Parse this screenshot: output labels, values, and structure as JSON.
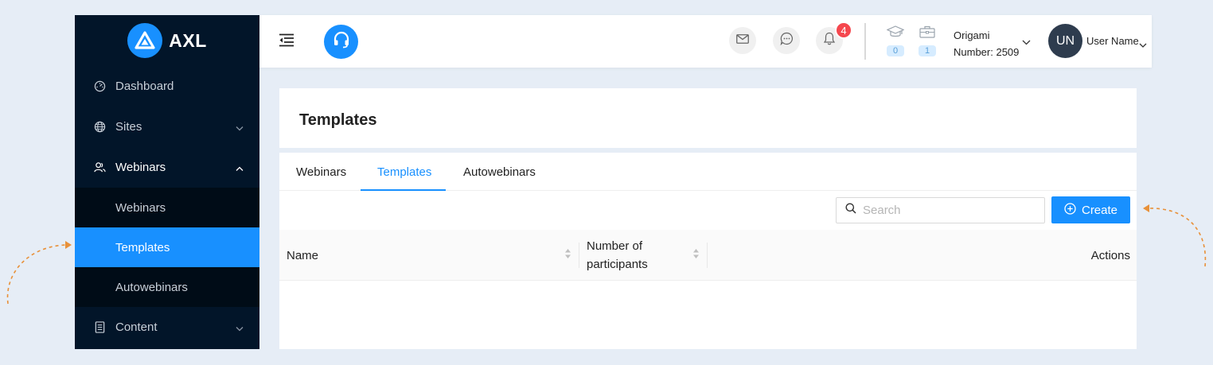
{
  "app": {
    "logo_text": "AXL",
    "accent_color": "#1890ff",
    "sidebar_bg": "#021529"
  },
  "sidebar": {
    "items": [
      {
        "label": "Dashboard",
        "icon": "dashboard-icon"
      },
      {
        "label": "Sites",
        "icon": "globe-icon",
        "expandable": true
      },
      {
        "label": "Webinars",
        "icon": "users-icon",
        "expandable": true,
        "expanded": true,
        "children": [
          {
            "label": "Webinars"
          },
          {
            "label": "Templates",
            "active": true
          },
          {
            "label": "Autowebinars"
          }
        ]
      },
      {
        "label": "Content",
        "icon": "document-icon",
        "expandable": true
      }
    ]
  },
  "header": {
    "notifications_count": "4",
    "courses_count": "0",
    "portfolio_count": "1",
    "org_name": "Origami",
    "org_number": "Number: 2509",
    "avatar_initials": "UN",
    "user_name": "User Name"
  },
  "page": {
    "title": "Templates",
    "tabs": [
      {
        "label": "Webinars"
      },
      {
        "label": "Templates",
        "active": true
      },
      {
        "label": "Autowebinars"
      }
    ],
    "search_placeholder": "Search",
    "create_label": "Create",
    "table": {
      "columns": [
        {
          "label": "Name",
          "sortable": true
        },
        {
          "label_line1": "Number of",
          "label_line2": "participants",
          "sortable": true
        },
        {
          "label": "Actions"
        }
      ],
      "rows": []
    }
  }
}
